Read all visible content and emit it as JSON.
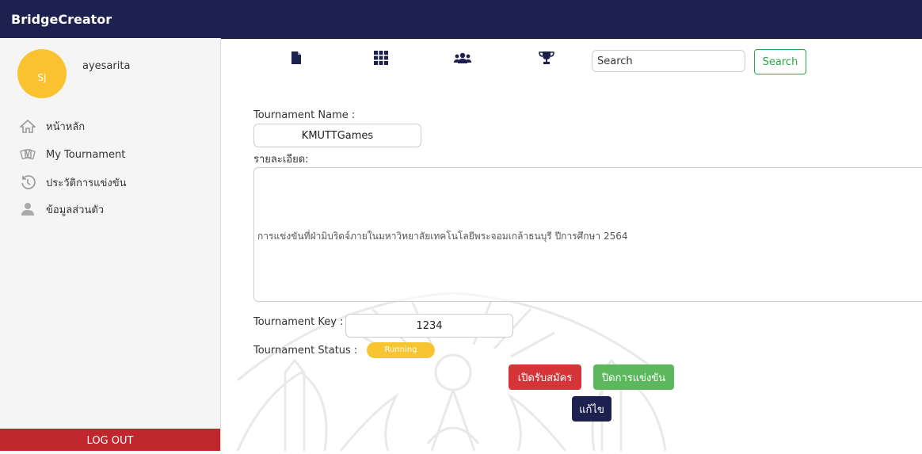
{
  "app": {
    "title": "BridgeCreator"
  },
  "user": {
    "initials": "SJ",
    "name": "ayesarita"
  },
  "sidebar": {
    "items": [
      {
        "label": "หน้าหลัก",
        "icon": "home-icon"
      },
      {
        "label": "My Tournament",
        "icon": "cards-icon"
      },
      {
        "label": "ประวัติการแข่งขัน",
        "icon": "history-icon"
      },
      {
        "label": "ข้อมูลส่วนตัว",
        "icon": "user-icon"
      }
    ],
    "logout_label": "LOG OUT"
  },
  "toolbar": {
    "icons": [
      "document-icon",
      "grid-icon",
      "users-icon",
      "trophy-icon"
    ],
    "search_placeholder": "Search",
    "search_button": "Search"
  },
  "form": {
    "tournament_name_label": "Tournament Name :",
    "tournament_name_value": "KMUTTGames",
    "description_label": "รายละเอียด:",
    "description_value": "การแข่งขันที่ฝ่ามิบริดจ์ภายในมหาวิทยาลัยเทคโนโลยีพระจอมเกล้าธนบุรี ปีการศึกษา 2564",
    "tournament_key_label": "Tournament Key :",
    "tournament_key_value": "1234",
    "tournament_status_label": "Tournament Status :",
    "tournament_status_value": "Running"
  },
  "actions": {
    "open_registration": "เปิดรับสมัคร",
    "close_competition": "ปิดการแข่งขัน",
    "edit": "แก้ไข"
  },
  "colors": {
    "topbar": "#1d2150",
    "avatar": "#f9c22e",
    "logout": "#c0262d",
    "open_button": "#d63537",
    "close_button": "#5cb85c",
    "edit_button": "#1d2150",
    "status_badge": "#f7c531",
    "search_button": "#28a745"
  }
}
